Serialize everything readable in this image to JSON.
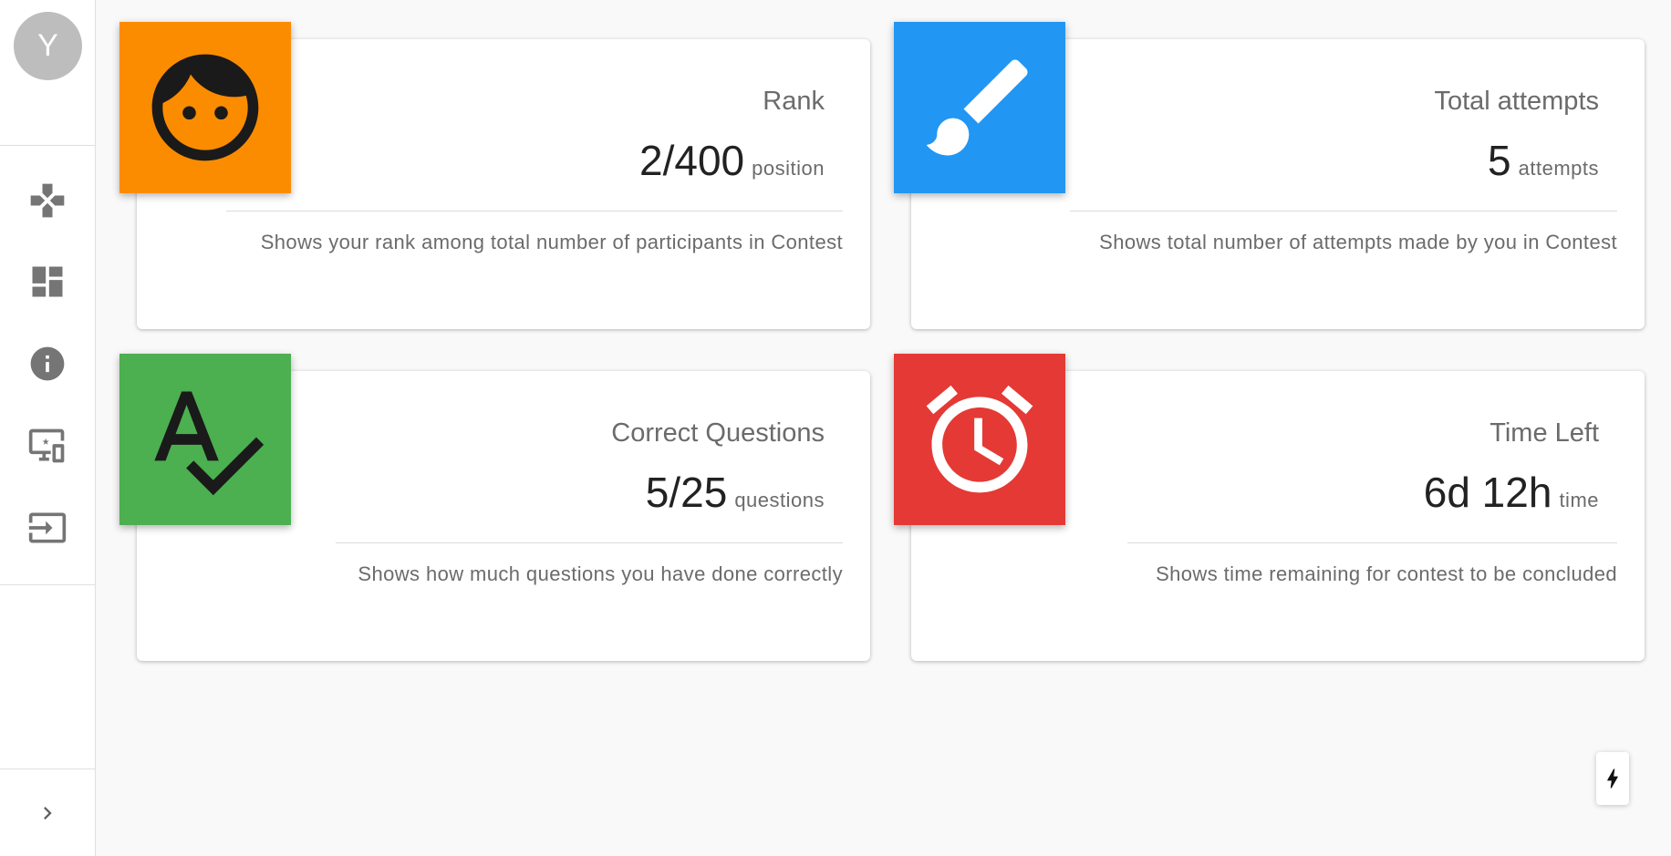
{
  "user": {
    "avatar_initial": "Y"
  },
  "sidebar": {
    "items": [
      {
        "icon": "gamepad-icon"
      },
      {
        "icon": "dashboard-icon"
      },
      {
        "icon": "info-icon"
      },
      {
        "icon": "devices-star-icon"
      },
      {
        "icon": "login-icon"
      }
    ],
    "expand_icon": "chevron-right-icon"
  },
  "cards": {
    "rank": {
      "title": "Rank",
      "value": "2/400",
      "unit": "position",
      "description": "Shows your rank among total number of participants in Contest",
      "icon": "face-icon",
      "color": "#fb8c00"
    },
    "attempts": {
      "title": "Total attempts",
      "value": "5",
      "unit": "attempts",
      "description": "Shows total number of attempts made by you in Contest",
      "icon": "brush-icon",
      "color": "#2196f3"
    },
    "correct": {
      "title": "Correct Questions",
      "value": "5/25",
      "unit": "questions",
      "description": "Shows how much questions you have done correctly",
      "icon": "spellcheck-icon",
      "color": "#4caf50"
    },
    "time": {
      "title": "Time Left",
      "value": "6d 12h",
      "unit": "time",
      "description": "Shows time remaining for contest to be concluded",
      "icon": "alarm-icon",
      "color": "#e53935"
    }
  },
  "fab": {
    "icon": "bolt-icon"
  }
}
